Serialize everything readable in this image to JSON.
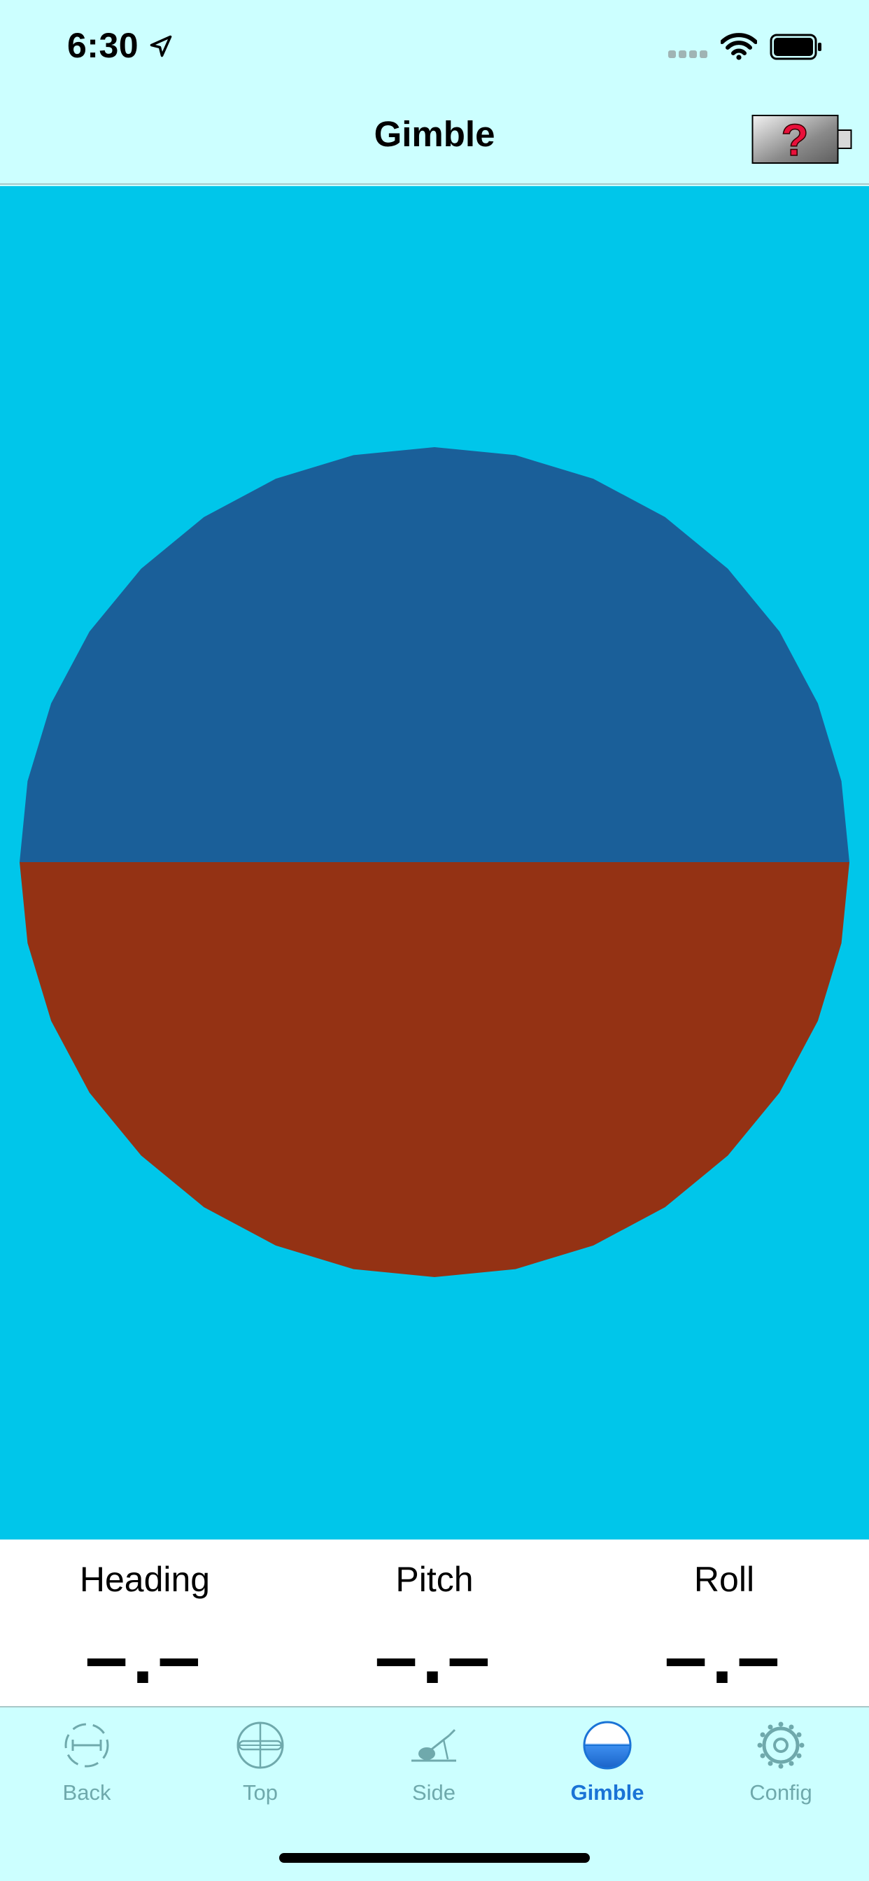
{
  "status_bar": {
    "time": "6:30",
    "icons": [
      "location-arrow-icon",
      "cellular-signal-icon",
      "wifi-icon",
      "battery-icon"
    ]
  },
  "nav": {
    "title": "Gimble",
    "right_button_icon": "battery-question-icon"
  },
  "gimble": {
    "background_color": "#00c6ea",
    "sky_color": "#1a5f99",
    "ground_color": "#943214"
  },
  "readouts": [
    {
      "label": "Heading",
      "value": "–.–"
    },
    {
      "label": "Pitch",
      "value": "–.–"
    },
    {
      "label": "Roll",
      "value": "–.–"
    }
  ],
  "tabs": [
    {
      "label": "Back",
      "icon": "back-view-icon",
      "active": false
    },
    {
      "label": "Top",
      "icon": "top-view-icon",
      "active": false
    },
    {
      "label": "Side",
      "icon": "side-view-icon",
      "active": false
    },
    {
      "label": "Gimble",
      "icon": "gimble-icon",
      "active": true
    },
    {
      "label": "Config",
      "icon": "gear-icon",
      "active": false
    }
  ],
  "colors": {
    "bar_background": "#ccffff",
    "tab_inactive": "#6fa9ac",
    "tab_active": "#1a73d6"
  }
}
